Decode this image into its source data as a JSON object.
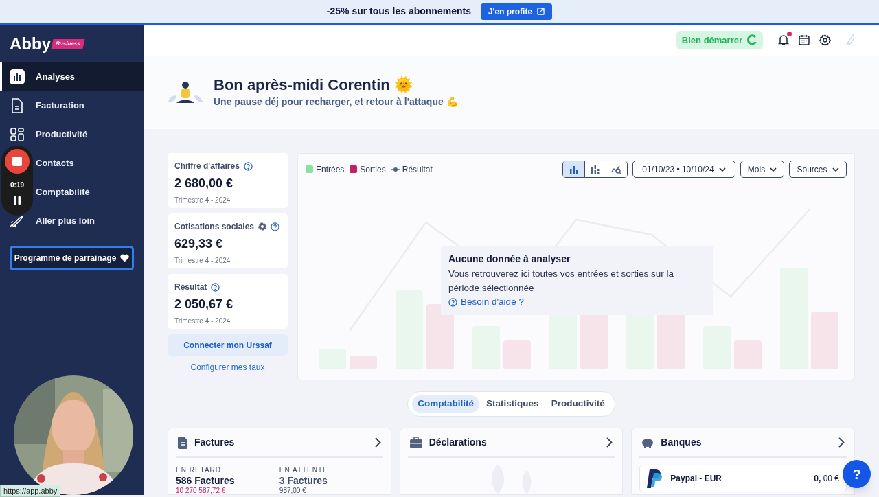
{
  "promo_banner": {
    "text": "-25% sur tous les abonnements",
    "button": "J'en profite"
  },
  "sidebar": {
    "logo": "Abby",
    "logo_badge": "Business",
    "items": [
      {
        "label": "Analyses",
        "selected": true
      },
      {
        "label": "Facturation",
        "selected": false
      },
      {
        "label": "Productivité",
        "selected": false
      },
      {
        "label": "Contacts",
        "selected": false
      },
      {
        "label": "Comptabilité",
        "selected": false
      },
      {
        "label": "Aller plus loin",
        "selected": false
      }
    ],
    "referral_button": "Programme de parrainage"
  },
  "recorder": {
    "time": "0:19"
  },
  "url_tooltip": "https://app.abby",
  "header": {
    "start_button": "Bien démarrer"
  },
  "greeting": {
    "title": "Bon après-midi Corentin 🌞",
    "subtitle": "Une pause déj pour recharger, et retour à l'attaque 💪"
  },
  "kpis": [
    {
      "label": "Chiffre d'affaires",
      "value": "2 680,00 €",
      "period": "Trimestre 4 - 2024",
      "settings": false
    },
    {
      "label": "Cotisations sociales",
      "value": "629,33 €",
      "period": "Trimestre 4 - 2024",
      "settings": true
    },
    {
      "label": "Résultat",
      "value": "2 050,67 €",
      "period": "Trimestre 4 - 2024",
      "settings": false
    }
  ],
  "urssaf_button": "Connecter mon Urssaf",
  "rates_link": "Configurer mes taux",
  "chart_card": {
    "legend": [
      {
        "label": "Entrées",
        "kind": "square",
        "color": "#86e3a0"
      },
      {
        "label": "Sorties",
        "kind": "square",
        "color": "#c81e63"
      },
      {
        "label": "Résultat",
        "kind": "line",
        "color": "#52617f"
      }
    ],
    "view_toggles": [
      {
        "selected": true
      },
      {
        "selected": false
      },
      {
        "selected": false
      }
    ],
    "date_range": "01/10/23 • 10/10/24",
    "granularity": "Mois",
    "sources": "Sources",
    "empty_title": "Aucune donnée à analyser",
    "empty_text": "Vous retrouverez ici toutes vos entrées et sorties sur la période sélectionnée",
    "help_link": "Besoin d'aide ?"
  },
  "tabs": [
    {
      "label": "Comptabilité",
      "selected": true
    },
    {
      "label": "Statistiques",
      "selected": false
    },
    {
      "label": "Productivité",
      "selected": false
    }
  ],
  "cards": [
    {
      "title": "Factures",
      "kind": "invoices",
      "stats": [
        {
          "label": "EN RETARD",
          "count": "586 Factures",
          "amount": "10 270 587,72 €",
          "late": true
        },
        {
          "label": "EN ATTENTE",
          "count": "3 Factures",
          "amount": "987,00 €",
          "late": false
        }
      ]
    },
    {
      "title": "Déclarations",
      "kind": "empty"
    },
    {
      "title": "Banques",
      "kind": "banks",
      "accounts": [
        {
          "name": "Paypal - EUR",
          "balance_int": "0,",
          "balance_dec": "00 €"
        }
      ]
    }
  ],
  "help_button": "?"
}
